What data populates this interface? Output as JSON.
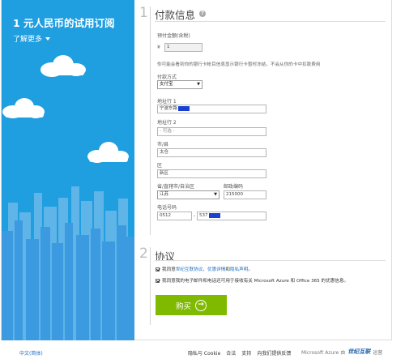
{
  "promo": {
    "title": "1 元人民币的试用订阅",
    "learn_more": "了解更多"
  },
  "step1": {
    "number": "1",
    "title": "付款信息",
    "amount_label": "预付金额(含税)",
    "currency_symbol": "¥",
    "amount_value": "1",
    "note": "你可能会看到你的银行卡帐目信息显示银行卡暂时冻结，不会从你的卡中扣款费用",
    "payment_method_label": "付款方式",
    "payment_method_value": "支付宝",
    "address1_label": "地址行 1",
    "address1_value": "宁波东路",
    "address2_label": "地址行 2",
    "address2_placeholder": "- 可选 -",
    "city_label": "市/县",
    "city_value": "太仓",
    "district_label": "区",
    "district_value": "新区",
    "province_label": "省/直辖市/自治区",
    "province_value": "江苏",
    "postcode_label": "邮政编码",
    "postcode_value": "215000",
    "phone_label": "电话号码",
    "phone_area": "0512",
    "phone_sep": "-",
    "phone_number": "537"
  },
  "step2": {
    "number": "2",
    "title": "协议",
    "agree1_prefix": "我同意",
    "agree1_link1": "世纪互联协议",
    "agree1_sep": "、",
    "agree1_link2": "优惠详情",
    "agree1_and": "和",
    "agree1_link3": "隐私声明",
    "agree1_end": "。",
    "agree2": "我同意我的电子邮件和电话还可用于接收有关 Microsoft Azure 和 Office 365 的优惠信息。"
  },
  "buy_button": {
    "label": "购买"
  },
  "footer": {
    "language": "中文(简体)",
    "links": [
      "隐私与 Cookie",
      "合法",
      "支持",
      "向我们提供反馈"
    ],
    "brand_prefix": "Microsoft Azure 由",
    "brand_name": "世纪互联",
    "brand_suffix": "运营"
  },
  "colors": {
    "promo_blue": "#1f9ee0",
    "buy_green": "#7fba00",
    "link_blue": "#1a6fc4",
    "redaction_blue": "#1b3fd0"
  },
  "icons": {
    "help": "help-circle-icon",
    "chevron": "chevron-down-icon",
    "arrow": "arrow-right-circle-icon",
    "checkbox": "checkbox-checked-icon"
  }
}
